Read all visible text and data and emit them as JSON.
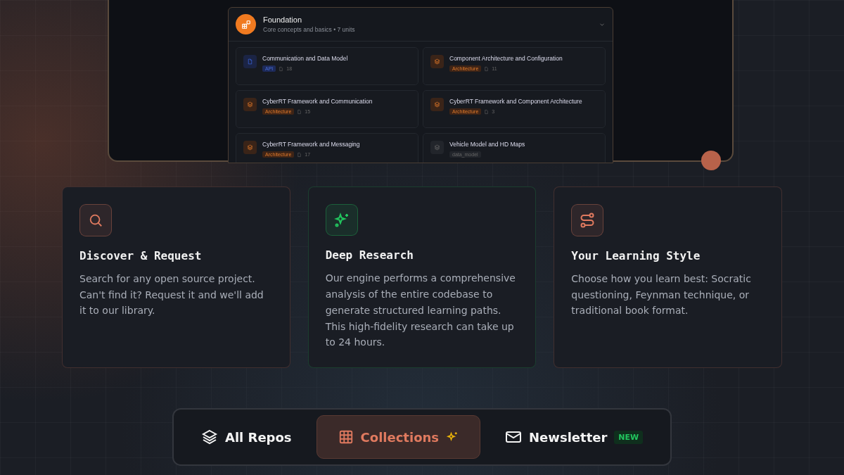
{
  "module": {
    "title": "Foundation",
    "subtitle": "Core concepts and basics • 7 units",
    "expanded": true,
    "units": [
      {
        "title": "Communication and Data Model",
        "kind": "api",
        "tag": "API",
        "count": "18"
      },
      {
        "title": "Component Architecture and Configuration",
        "kind": "architecture",
        "tag": "Architecture",
        "count": "11"
      },
      {
        "title": "CyberRT Framework and Communication",
        "kind": "architecture",
        "tag": "Architecture",
        "count": "15"
      },
      {
        "title": "CyberRT Framework and Component Architecture",
        "kind": "architecture",
        "tag": "Architecture",
        "count": "3"
      },
      {
        "title": "CyberRT Framework and Messaging",
        "kind": "architecture",
        "tag": "Architecture",
        "count": "17"
      },
      {
        "title": "Vehicle Model and HD Maps",
        "kind": "other",
        "tag": "data_model"
      }
    ]
  },
  "features": [
    {
      "kind": "search",
      "color": "#e07a5f",
      "title": "Discover & Request",
      "text": "Search for any open source project. Can't find it? Request it and we'll add it to our library."
    },
    {
      "kind": "sparkle",
      "color": "#22c55e",
      "title": "Deep Research",
      "text": "Our engine performs a comprehensive analysis of the entire codebase to generate structured learning paths. This high-fidelity research can take up to 24 hours."
    },
    {
      "kind": "route",
      "color": "#e07a5f",
      "title": "Your Learning Style",
      "text": "Choose how you learn best: Socratic questioning, Feynman technique, or traditional book format."
    }
  ],
  "nav": [
    {
      "kind": "layers",
      "label": "All Repos",
      "selected": false
    },
    {
      "kind": "grid",
      "label": "Collections",
      "selected": true
    },
    {
      "kind": "mail",
      "label": "Newsletter",
      "selected": false,
      "badge": "NEW"
    }
  ]
}
